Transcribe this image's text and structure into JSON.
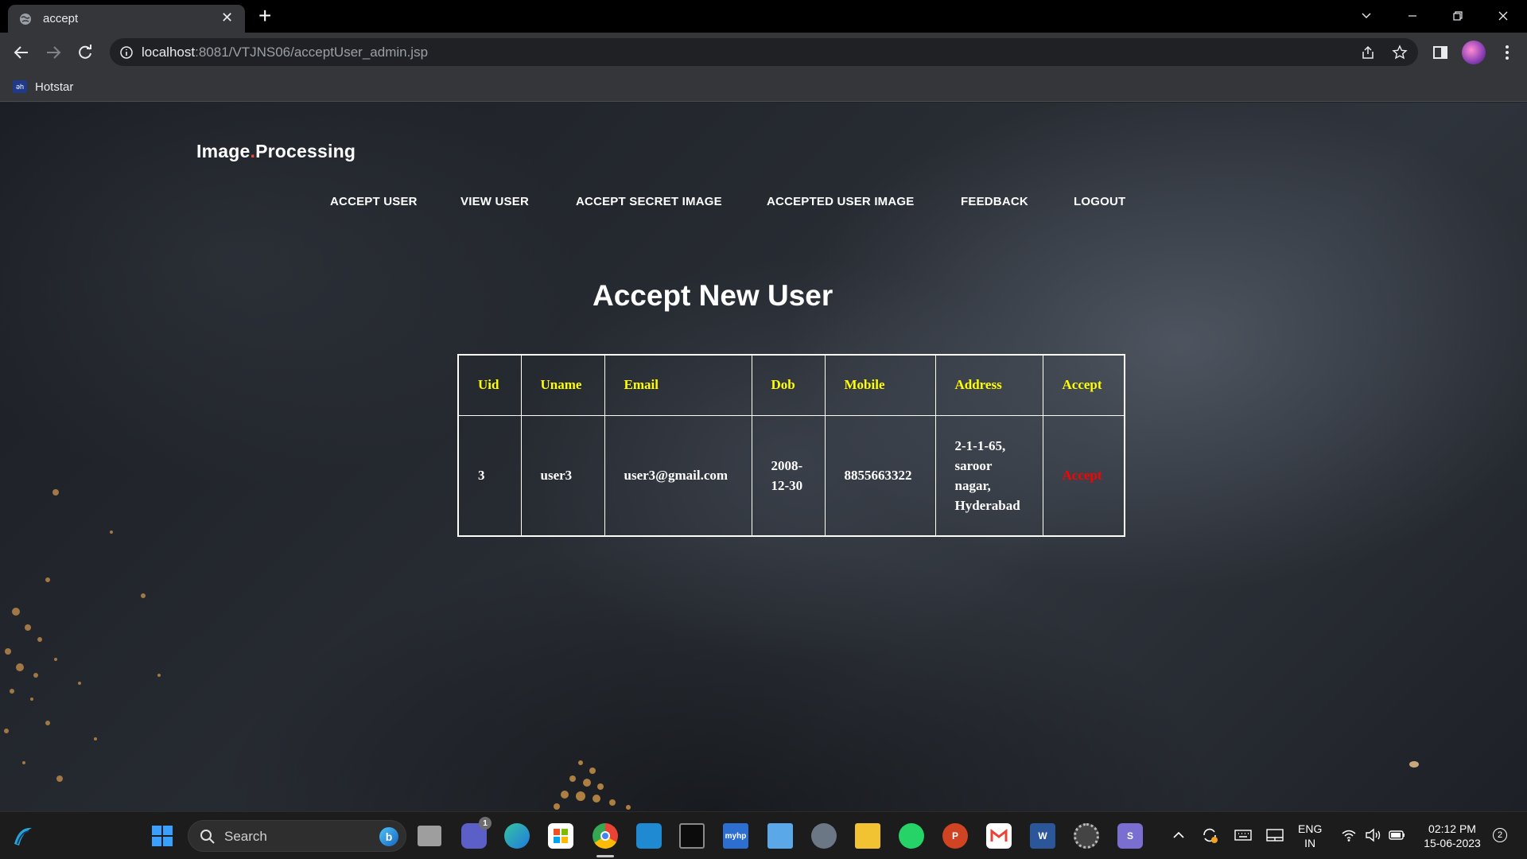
{
  "browser": {
    "tab_title": "accept",
    "tab_close": "✕",
    "new_tab": "+",
    "url_host": "localhost",
    "url_rest": ":8081/VTJNS06/acceptUser_admin.jsp",
    "bookmark_label": "Hotstar",
    "bookmark_icon_text": "ǝh"
  },
  "site": {
    "brand_first": "Image",
    "brand_dot": ".",
    "brand_second": "Processing",
    "nav": [
      "ACCEPT USER",
      "VIEW USER",
      "ACCEPT SECRET IMAGE",
      "ACCEPTED USER IMAGE",
      "FEEDBACK",
      "LOGOUT"
    ],
    "heading": "Accept New User"
  },
  "table": {
    "headers": [
      "Uid",
      "Uname",
      "Email",
      "Dob",
      "Mobile",
      "Address",
      "Accept"
    ],
    "rows": [
      {
        "uid": "3",
        "uname": "user3",
        "email": "user3@gmail.com",
        "dob_line1": "2008-",
        "dob_line2": "12-30",
        "mobile": "8855663322",
        "addr_line1": "2-1-1-65,",
        "addr_line2": "saroor",
        "addr_line3": "nagar,",
        "addr_line4": "Hyderabad",
        "accept": "Accept"
      }
    ],
    "header_color": "#ffff00",
    "accept_color": "#ff0000"
  },
  "taskbar": {
    "search_placeholder": "Search",
    "teams_badge": "1",
    "lang_line1": "ENG",
    "lang_line2": "IN",
    "time": "02:12 PM",
    "date": "15-06-2023",
    "notification_count": "2"
  }
}
